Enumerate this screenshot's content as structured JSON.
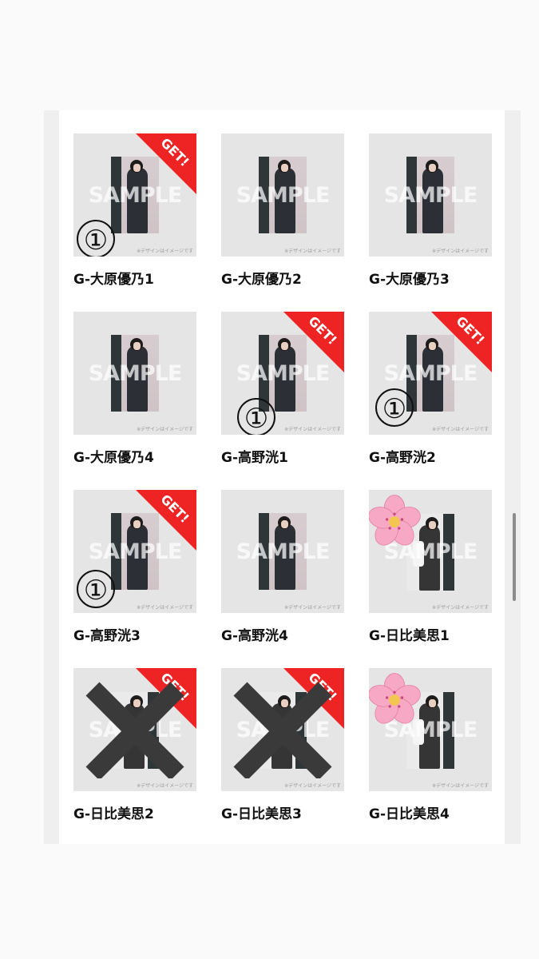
{
  "note_text": "※デザインはイメージです",
  "watermark_text": "SAMPLE",
  "badge_text": "GET!",
  "number_mark_text": "①",
  "items": [
    {
      "label": "G-大原優乃1",
      "get": true,
      "mark": "number",
      "photo": "ohara"
    },
    {
      "label": "G-大原優乃2",
      "get": false,
      "mark": "none",
      "photo": "ohara"
    },
    {
      "label": "G-大原優乃3",
      "get": false,
      "mark": "none",
      "photo": "ohara"
    },
    {
      "label": "G-大原優乃4",
      "get": false,
      "mark": "none",
      "photo": "ohara"
    },
    {
      "label": "G-高野洸1",
      "get": true,
      "mark": "number",
      "photo": "takano"
    },
    {
      "label": "G-高野洸2",
      "get": true,
      "mark": "number",
      "photo": "takano"
    },
    {
      "label": "G-高野洸3",
      "get": true,
      "mark": "number",
      "photo": "takano"
    },
    {
      "label": "G-高野洸4",
      "get": false,
      "mark": "none",
      "photo": "takano"
    },
    {
      "label": "G-日比美思1",
      "get": false,
      "mark": "flower",
      "photo": "hino"
    },
    {
      "label": "G-日比美思2",
      "get": true,
      "mark": "cross",
      "photo": "hino"
    },
    {
      "label": "G-日比美思3",
      "get": true,
      "mark": "cross",
      "photo": "hino"
    },
    {
      "label": "G-日比美思4",
      "get": false,
      "mark": "flower",
      "photo": "hino"
    }
  ],
  "colors": {
    "ribbon": "#ee2424",
    "flower": "#f7a8c4",
    "cross": "#3a3a3a"
  }
}
